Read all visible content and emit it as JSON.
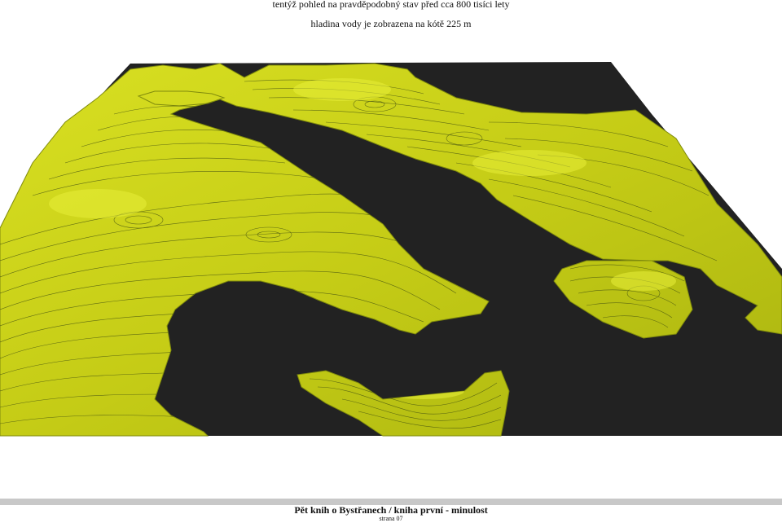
{
  "header": {
    "line1": "tentýž pohled na pravděpodobný stav před cca 800 tisíci lety",
    "line2": "hladina vody je zobrazena na kótě 225 m"
  },
  "render": {
    "water_color": "#222222",
    "land_color": "#c8cf1a",
    "land_highlight": "#e4ec2a",
    "contour_color": "#3c4a12"
  },
  "footer": {
    "title": "Pět knih o Bystřanech / kniha první - minulost",
    "page": "strana 07",
    "bar_color": "#c8c8c8"
  }
}
